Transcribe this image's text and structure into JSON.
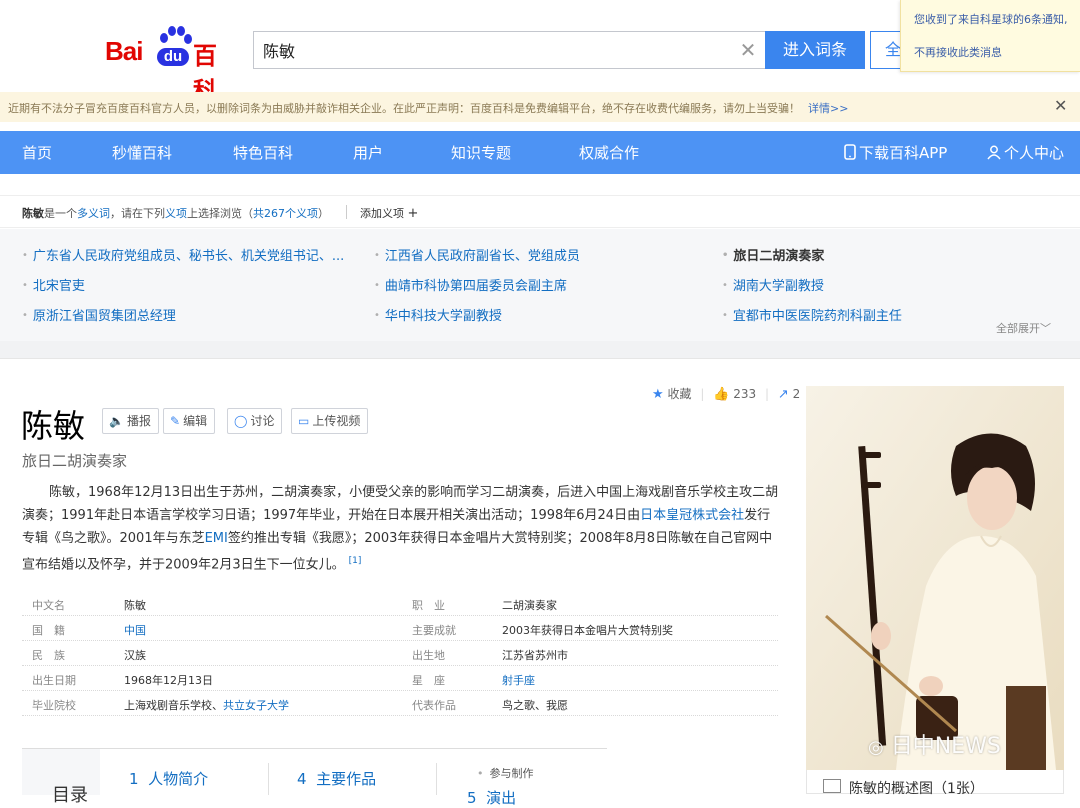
{
  "header": {
    "search_value": "陈敏",
    "enter_button": "进入词条",
    "fulltext_button": "全",
    "notification": "您收到了来自科星球的6条通知,",
    "notification_dismiss": "不再接收此类消息"
  },
  "notice": {
    "text": "近期有不法分子冒充百度百科官方人员，以删除词条为由威胁并敲诈相关企业。在此严正声明：百度百科是免费编辑平台，绝不存在收费代编服务，请勿上当受骗！",
    "detail_link": "详情>>"
  },
  "nav": {
    "items": [
      "首页",
      "秒懂百科",
      "特色百科",
      "用户",
      "知识专题",
      "权威合作"
    ],
    "download_app": "下载百科APP",
    "personal_center": "个人中心"
  },
  "polysemy": {
    "term": "陈敏",
    "text_mid": "是一个",
    "polysemy_link": "多义词",
    "text_mid2": "，请在下列",
    "sense_link": "义项",
    "text_mid3": "上选择浏览（",
    "count_link": "共267个义项",
    "text_end": "）",
    "add_sense": "添加义项",
    "items": [
      "广东省人民政府党组成员、秘书长、机关党组书记、...",
      "江西省人民政府副省长、党组成员",
      "旅日二胡演奏家",
      "北宋官吏",
      "曲靖市科协第四届委员会副主席",
      "湖南大学副教授",
      "原浙江省国贸集团总经理",
      "华中科技大学副教授",
      "宜都市中医医院药剂科副主任"
    ],
    "current": "旅日二胡演奏家",
    "expand_all": "全部展开"
  },
  "article": {
    "title": "陈敏",
    "subtitle": "旅日二胡演奏家",
    "tools": [
      "播报",
      "编辑",
      "讨论",
      "上传视频"
    ],
    "collect": "收藏",
    "likes": "233",
    "shares": "2",
    "summary_parts": [
      "陈敏，1968年12月13日出生于苏州，二胡演奏家，小便受父亲的影响而学习二胡演奏，后进入中国上海戏剧音乐学校主攻二胡演奏；1991年赴日本语言学校学习日语；1997年毕业，开始在日本展开相关演出活动；1998年6月24日由",
      "日本皇冠株式会社",
      "发行专辑《鸟之歌》。2001年与东芝",
      "EMI",
      "签约推出专辑《我愿》；2003年获得日本金唱片大赏特别奖；2008年8月8日陈敏在自己官网中宣布结婚以及怀孕，并于2009年2月3日生下一位女儿。",
      "[1]"
    ],
    "info": [
      {
        "k": "中文名",
        "v": "陈敏",
        "k2": "职　业",
        "v2": "二胡演奏家"
      },
      {
        "k": "国　籍",
        "v": "中国",
        "k2": "主要成就",
        "v2": "2003年获得日本金唱片大赏特别奖"
      },
      {
        "k": "民　族",
        "v": "汉族",
        "k2": "出生地",
        "v2": "江苏省苏州市"
      },
      {
        "k": "出生日期",
        "v": "1968年12月13日",
        "k2": "星　座",
        "v2": "射手座"
      },
      {
        "k": "毕业院校",
        "v": "上海戏剧音乐学校、",
        "v_link": "共立女子大学",
        "k2": "代表作品",
        "v2": "鸟之歌、我愿"
      }
    ],
    "toc": {
      "label": "目录",
      "items": [
        {
          "num": "1",
          "text": "人物简介"
        },
        {
          "num": "4",
          "text": "主要作品"
        },
        {
          "num": "5",
          "text": "演出"
        }
      ],
      "sub": "参与制作"
    }
  },
  "side": {
    "caption": "陈敏的概述图（1张）",
    "watermark": "日中NEWS"
  }
}
